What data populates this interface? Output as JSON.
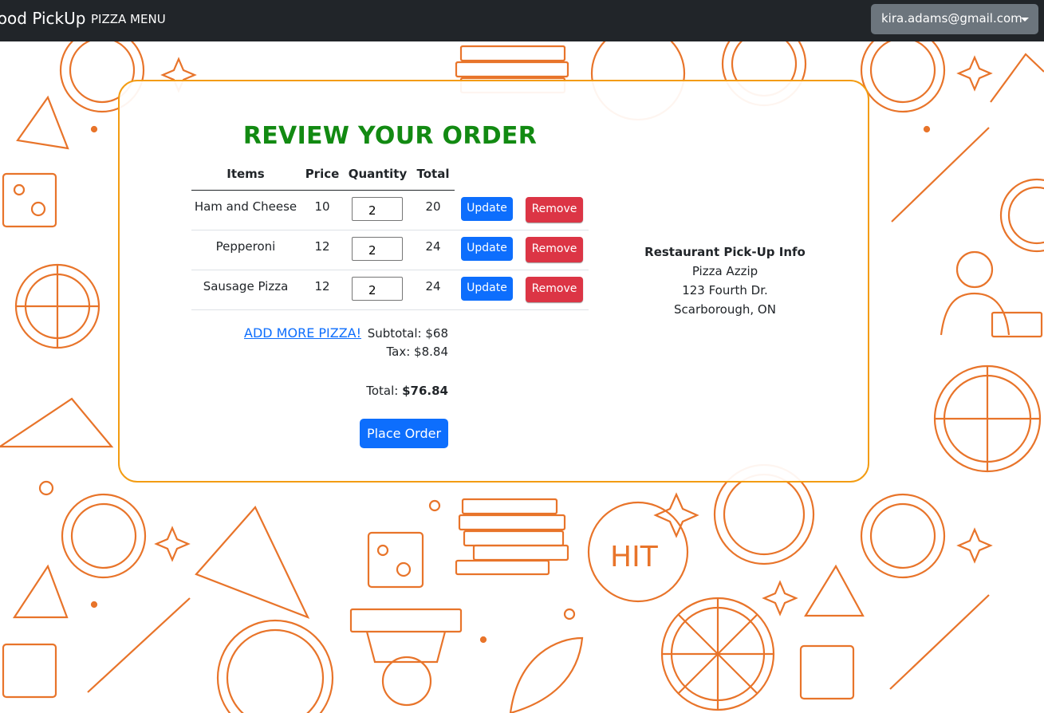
{
  "navbar": {
    "brand": "Food PickUp",
    "menu_link": "PIZZA MENU",
    "user_email": "kira.adams@gmail.com"
  },
  "order": {
    "title": "REVIEW YOUR ORDER",
    "headers": {
      "items": "Items",
      "price": "Price",
      "quantity": "Quantity",
      "total": "Total"
    },
    "rows": [
      {
        "item": "Ham and Cheese",
        "price": "10",
        "quantity": "2",
        "total": "20"
      },
      {
        "item": "Pepperoni",
        "price": "12",
        "quantity": "2",
        "total": "24"
      },
      {
        "item": "Sausage Pizza",
        "price": "12",
        "quantity": "2",
        "total": "24"
      }
    ],
    "update_label": "Update",
    "remove_label": "Remove",
    "add_more": "ADD MORE PIZZA!",
    "subtotal": "Subtotal: $68",
    "tax": "Tax: $8.84",
    "total_label": "Total: ",
    "total_value": "$76.84",
    "place_order": "Place Order"
  },
  "pickup": {
    "heading": "Restaurant Pick-Up Info",
    "name": "Pizza Azzip",
    "street": "123 Fourth Dr.",
    "city": "Scarborough, ON"
  },
  "colors": {
    "navbar": "#212529",
    "title_green": "#128a12",
    "primary": "#0d6efd",
    "danger": "#dc3545",
    "pattern_orange": "#e8742a",
    "card_border": "#f39c12"
  }
}
